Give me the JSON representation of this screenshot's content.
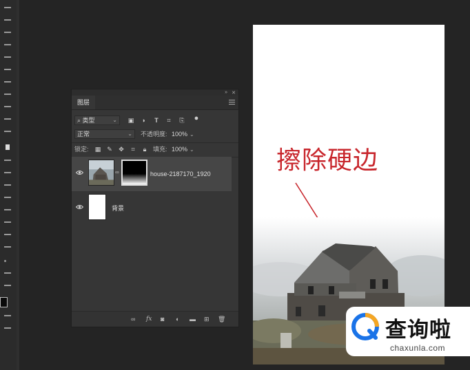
{
  "layers_panel": {
    "tab_label": "图层",
    "filter_kind": "类型",
    "blend_mode": "正常",
    "opacity_label": "不透明度:",
    "opacity_value": "100%",
    "lock_label": "锁定:",
    "fill_label": "填充:",
    "fill_value": "100%",
    "layers": [
      {
        "name": "house-2187170_1920",
        "selected": true,
        "has_mask": true
      },
      {
        "name": "背景",
        "selected": false,
        "has_mask": false
      }
    ],
    "bottom_icons": [
      "link-layers-icon",
      "fx-icon",
      "add-mask-icon",
      "adjustment-layer-icon",
      "new-group-icon",
      "new-layer-icon",
      "delete-layer-icon"
    ],
    "fx_label": "fx"
  },
  "canvas": {
    "annotation_text": "擦除硬边",
    "annotation_color": "#c8262c"
  },
  "watermark": {
    "title": "查询啦",
    "domain": "chaxunla.com",
    "accent_blue": "#1a73e8",
    "accent_orange": "#f5a623"
  }
}
